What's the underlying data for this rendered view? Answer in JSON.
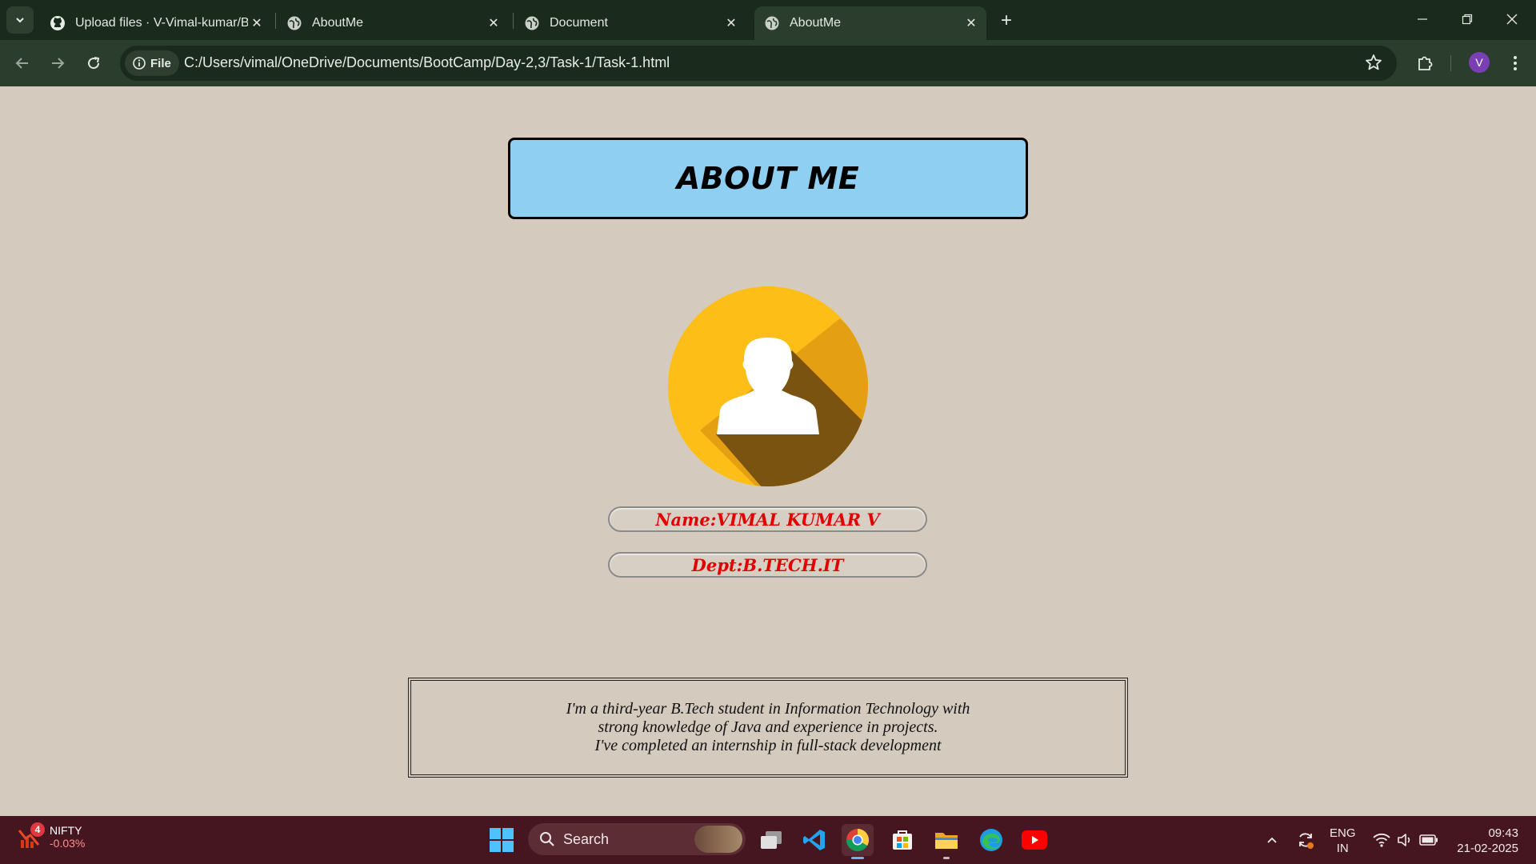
{
  "browser": {
    "tabs": [
      {
        "title": "Upload files · V-Vimal-kumar/Bc",
        "icon": "github-icon"
      },
      {
        "title": "AboutMe",
        "icon": "globe-icon"
      },
      {
        "title": "Document",
        "icon": "globe-icon"
      },
      {
        "title": "AboutMe",
        "icon": "globe-icon",
        "active": true
      }
    ],
    "address": {
      "chip_label": "File",
      "url": "C:/Users/vimal/OneDrive/Documents/BootCamp/Day-2,3/Task-1/Task-1.html"
    },
    "profile_initial": "V"
  },
  "page": {
    "heading": "ABOUT ME",
    "name": "Name:VIMAL KUMAR V",
    "dept": "Dept:B.TECH.IT",
    "about_lines": [
      "I'm a third-year B.Tech student in Information Technology with",
      "strong knowledge of Java and experience in projects.",
      "I've completed an internship in full-stack development"
    ],
    "colors": {
      "background": "#d4cbbe",
      "heading_bg": "#8ecff2",
      "pill_text": "#e20000",
      "avatar_circle": "#fdbf17",
      "avatar_shadow": "#7a5310"
    }
  },
  "taskbar": {
    "widget": {
      "badge": "4",
      "title": "NIFTY",
      "change": "-0.03%"
    },
    "search_label": "Search",
    "apps": [
      "task-view-icon",
      "vscode-icon",
      "chrome-icon",
      "microsoft-store-icon",
      "file-explorer-icon",
      "edge-icon",
      "youtube-icon"
    ],
    "tray": {
      "lang_top": "ENG",
      "lang_bottom": "IN",
      "time": "09:43",
      "date": "21-02-2025"
    }
  }
}
